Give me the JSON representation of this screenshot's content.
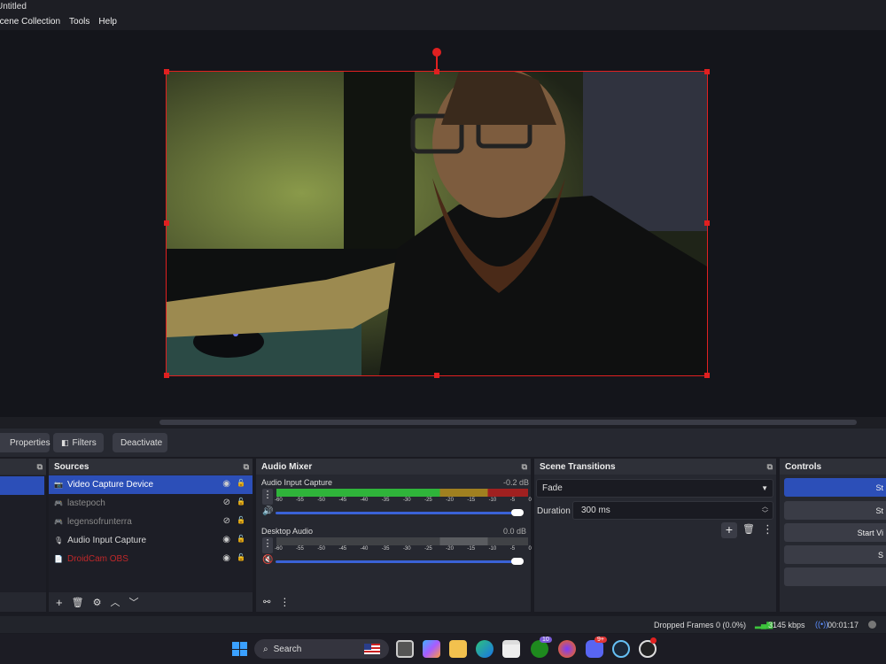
{
  "window": {
    "title": "Untitled"
  },
  "menu": [
    "Scene Collection",
    "Tools",
    "Help"
  ],
  "toolbar": {
    "properties": "Properties",
    "filters": "Filters",
    "deactivate": "Deactivate"
  },
  "docks": {
    "sources": {
      "title": "Sources",
      "items": [
        {
          "label": "Video Capture Device",
          "icon": "camera-icon",
          "selected": true,
          "hidden": false
        },
        {
          "label": "lastepoch",
          "icon": "gamepad-icon",
          "selected": false,
          "hidden": true
        },
        {
          "label": "legensofrunterra",
          "icon": "gamepad-icon",
          "selected": false,
          "hidden": true
        },
        {
          "label": "Audio Input Capture",
          "icon": "microphone-icon",
          "selected": false,
          "hidden": false
        },
        {
          "label": "DroidCam OBS",
          "icon": "document-icon",
          "selected": false,
          "hidden": false,
          "color": "#c0282a"
        }
      ]
    },
    "audio_mixer": {
      "title": "Audio Mixer",
      "channels": [
        {
          "name": "Audio Input Capture",
          "db": "-0.2 dB",
          "level": 0.99,
          "muted": false
        },
        {
          "name": "Desktop Audio",
          "db": "0.0 dB",
          "level": 0.0,
          "muted": true
        }
      ],
      "ticks": [
        "-60",
        "-55",
        "-50",
        "-45",
        "-40",
        "-35",
        "-30",
        "-25",
        "-20",
        "-15",
        "-10",
        "-5",
        "0"
      ]
    },
    "scene_transitions": {
      "title": "Scene Transitions",
      "transition": "Fade",
      "duration_label": "Duration",
      "duration": "300 ms"
    },
    "controls": {
      "title": "Controls",
      "buttons": [
        "St",
        "St",
        "Start Vi",
        "S",
        ""
      ]
    }
  },
  "status": {
    "dropped_frames": "Dropped Frames 0 (0.0%)",
    "bitrate": "3145 kbps",
    "time": "00:01:17"
  },
  "taskbar": {
    "search": "Search",
    "badges": {
      "xbox": "10",
      "discord": "9+"
    }
  }
}
